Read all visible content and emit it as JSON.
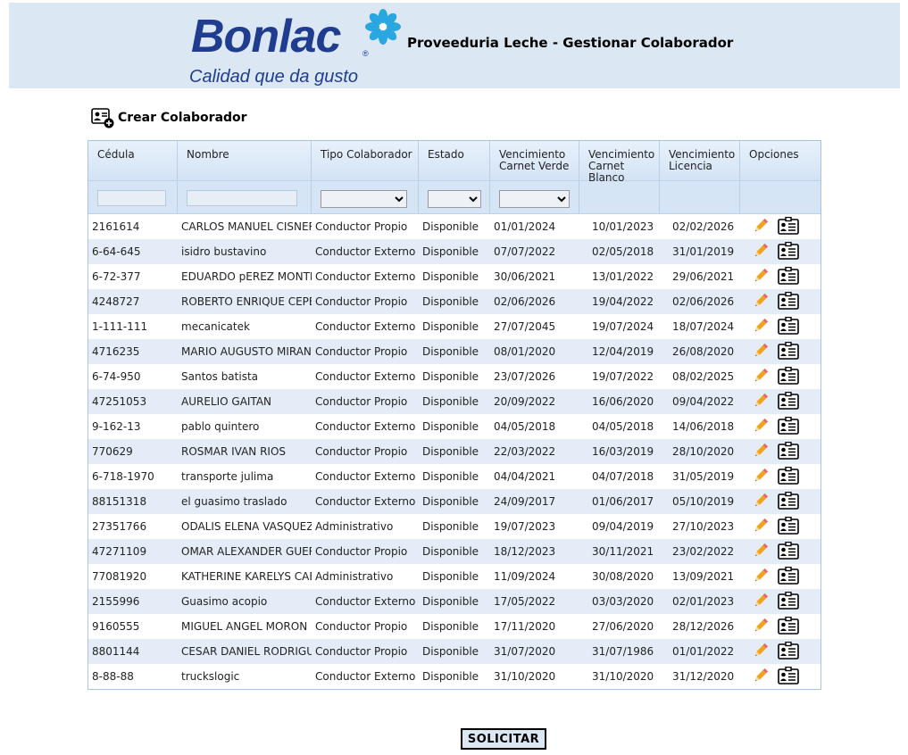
{
  "header": {
    "logo_text": "Bonlac",
    "logo_registered": "®",
    "logo_tagline": "Calidad que da gusto",
    "title": "Proveeduria Leche - Gestionar Colaborador"
  },
  "toolbar": {
    "create_label": "Crear Colaborador"
  },
  "grid": {
    "columns": [
      {
        "key": "cedula",
        "label": "Cédula"
      },
      {
        "key": "nombre",
        "label": "Nombre"
      },
      {
        "key": "tipo",
        "label": "Tipo Colaborador"
      },
      {
        "key": "estado",
        "label": "Estado"
      },
      {
        "key": "venc_verde",
        "label": "Vencimiento Carnet Verde"
      },
      {
        "key": "venc_blanco",
        "label": "Vencimiento Carnet Blanco"
      },
      {
        "key": "venc_licencia",
        "label": "Vencimiento Licencia"
      },
      {
        "key": "opciones",
        "label": "Opciones"
      }
    ],
    "rows": [
      {
        "cedula": "2161614",
        "nombre": "CARLOS MANUEL CISNEROS",
        "tipo": "Conductor Propio",
        "estado": "Disponible",
        "venc_verde": "01/01/2024",
        "venc_blanco": "10/01/2023",
        "venc_licencia": "02/02/2026"
      },
      {
        "cedula": "6-64-645",
        "nombre": "isidro bustavino",
        "tipo": "Conductor Externo",
        "estado": "Disponible",
        "venc_verde": "07/07/2022",
        "venc_blanco": "02/05/2018",
        "venc_licencia": "31/01/2019"
      },
      {
        "cedula": "6-72-377",
        "nombre": "EDUARDO pEREZ MONTENEGRO",
        "tipo": "Conductor Externo",
        "estado": "Disponible",
        "venc_verde": "30/06/2021",
        "venc_blanco": "13/01/2022",
        "venc_licencia": "29/06/2021"
      },
      {
        "cedula": "4248727",
        "nombre": "ROBERTO ENRIQUE CEPEDA",
        "tipo": "Conductor Propio",
        "estado": "Disponible",
        "venc_verde": "02/06/2026",
        "venc_blanco": "19/04/2022",
        "venc_licencia": "02/06/2026"
      },
      {
        "cedula": "1-111-111",
        "nombre": "mecanicatek",
        "tipo": "Conductor Externo",
        "estado": "Disponible",
        "venc_verde": "27/07/2045",
        "venc_blanco": "19/07/2024",
        "venc_licencia": "18/07/2024"
      },
      {
        "cedula": "4716235",
        "nombre": "MARIO AUGUSTO MIRANDA",
        "tipo": "Conductor Propio",
        "estado": "Disponible",
        "venc_verde": "08/01/2020",
        "venc_blanco": "12/04/2019",
        "venc_licencia": "26/08/2020"
      },
      {
        "cedula": "6-74-950",
        "nombre": "Santos batista",
        "tipo": "Conductor Externo",
        "estado": "Disponible",
        "venc_verde": "23/07/2026",
        "venc_blanco": "19/07/2022",
        "venc_licencia": "08/02/2025"
      },
      {
        "cedula": "47251053",
        "nombre": "AURELIO GAITAN",
        "tipo": "Conductor Propio",
        "estado": "Disponible",
        "venc_verde": "20/09/2022",
        "venc_blanco": "16/06/2020",
        "venc_licencia": "09/04/2022"
      },
      {
        "cedula": "9-162-13",
        "nombre": "pablo quintero",
        "tipo": "Conductor Externo",
        "estado": "Disponible",
        "venc_verde": "04/05/2018",
        "venc_blanco": "04/05/2018",
        "venc_licencia": "14/06/2018"
      },
      {
        "cedula": "770629",
        "nombre": "ROSMAR IVAN RIOS",
        "tipo": "Conductor Propio",
        "estado": "Disponible",
        "venc_verde": "22/03/2022",
        "venc_blanco": "16/03/2019",
        "venc_licencia": "28/10/2020"
      },
      {
        "cedula": "6-718-1970",
        "nombre": "transporte julima",
        "tipo": "Conductor Externo",
        "estado": "Disponible",
        "venc_verde": "04/04/2021",
        "venc_blanco": "04/07/2018",
        "venc_licencia": "31/05/2019"
      },
      {
        "cedula": "88151318",
        "nombre": "el guasimo traslado",
        "tipo": "Conductor Externo",
        "estado": "Disponible",
        "venc_verde": "24/09/2017",
        "venc_blanco": "01/06/2017",
        "venc_licencia": "05/10/2019"
      },
      {
        "cedula": "27351766",
        "nombre": "ODALIS ELENA VASQUEZ",
        "tipo": "Administrativo",
        "estado": "Disponible",
        "venc_verde": "19/07/2023",
        "venc_blanco": "09/04/2019",
        "venc_licencia": "27/10/2023"
      },
      {
        "cedula": "47271109",
        "nombre": "OMAR ALEXANDER GUERRA",
        "tipo": "Conductor Propio",
        "estado": "Disponible",
        "venc_verde": "18/12/2023",
        "venc_blanco": "30/11/2021",
        "venc_licencia": "23/02/2022"
      },
      {
        "cedula": "77081920",
        "nombre": "KATHERINE KARELYS CABA",
        "tipo": "Administrativo",
        "estado": "Disponible",
        "venc_verde": "11/09/2024",
        "venc_blanco": "30/08/2020",
        "venc_licencia": "13/09/2021"
      },
      {
        "cedula": "2155996",
        "nombre": "Guasimo acopio",
        "tipo": "Conductor Externo",
        "estado": "Disponible",
        "venc_verde": "17/05/2022",
        "venc_blanco": "03/03/2020",
        "venc_licencia": "02/01/2023"
      },
      {
        "cedula": "9160555",
        "nombre": "MIGUEL ANGEL MORON",
        "tipo": "Conductor Propio",
        "estado": "Disponible",
        "venc_verde": "17/11/2020",
        "venc_blanco": "27/06/2020",
        "venc_licencia": "28/12/2026"
      },
      {
        "cedula": "8801144",
        "nombre": "CESAR DANIEL RODRIGUEZ",
        "tipo": "Conductor Propio",
        "estado": "Disponible",
        "venc_verde": "31/07/2020",
        "venc_blanco": "31/07/1986",
        "venc_licencia": "01/01/2022"
      },
      {
        "cedula": "8-88-88",
        "nombre": "truckslogic",
        "tipo": "Conductor Externo",
        "estado": "Disponible",
        "venc_verde": "31/10/2020",
        "venc_blanco": "31/10/2020",
        "venc_licencia": "31/12/2020"
      }
    ],
    "row_icons": [
      "pencil-icon",
      "contact-card-icon"
    ]
  },
  "footer": {
    "submit_label": "SOLICITAR"
  },
  "colors": {
    "brand_blue": "#1f3c8f",
    "flower_blue": "#2aa7e0",
    "header_bg": "#dbe7f3",
    "alt_row": "#e4edf7"
  }
}
